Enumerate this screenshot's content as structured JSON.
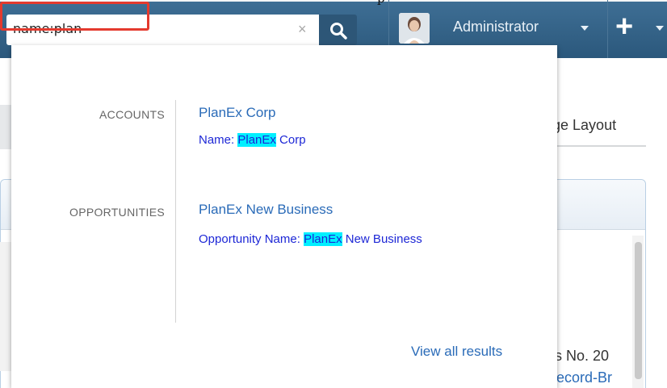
{
  "top_strip": {
    "text": "p"
  },
  "search": {
    "value": "name:plan",
    "clear_icon": "×",
    "button_icon": "search-icon"
  },
  "user": {
    "name": "Administrator"
  },
  "quick_create": {
    "icon": "+"
  },
  "background": {
    "change_layout": "nge Layout",
    "row_text": "s No. 20",
    "row_link": "ecord-Br"
  },
  "results": {
    "accounts": {
      "label": "ACCOUNTS",
      "title": "PlanEx Corp",
      "detail_prefix": "Name: ",
      "detail_match": "PlanEx",
      "detail_suffix": " Corp"
    },
    "opportunities": {
      "label": "OPPORTUNITIES",
      "title": "PlanEx New Business",
      "detail_prefix": "Opportunity Name: ",
      "detail_match": "PlanEx",
      "detail_suffix": " New Business"
    },
    "view_all": "View all results"
  },
  "colors": {
    "nav_bar": "#2b587c",
    "search_highlight_border": "#e43a2e",
    "match_highlight": "#00f0ff",
    "link": "#2a6bb8",
    "detail_text": "#1d27d6"
  }
}
